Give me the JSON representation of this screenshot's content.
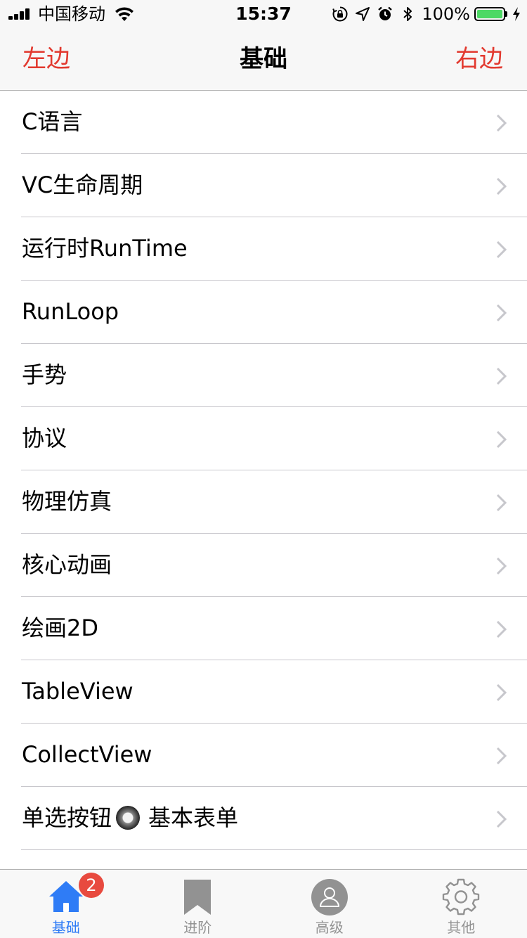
{
  "status_bar": {
    "carrier": "中国移动",
    "time": "15:37",
    "battery_percent": "100%",
    "icons": [
      "signal-icon",
      "wifi-icon",
      "orientation-lock-icon",
      "location-icon",
      "alarm-icon",
      "bluetooth-icon",
      "battery-icon",
      "charging-icon"
    ]
  },
  "nav": {
    "left_label": "左边",
    "title": "基础",
    "right_label": "右边",
    "accent_color": "#e2392f"
  },
  "list": {
    "items": [
      {
        "label": "C语言"
      },
      {
        "label": "VC生命周期"
      },
      {
        "label": "运行时RunTime"
      },
      {
        "label": "RunLoop"
      },
      {
        "label": "手势"
      },
      {
        "label": "协议"
      },
      {
        "label": "物理仿真"
      },
      {
        "label": "核心动画"
      },
      {
        "label": "绘画2D"
      },
      {
        "label": "TableView"
      },
      {
        "label": "CollectView"
      },
      {
        "label_before": "单选按钮",
        "label_after": "基本表单"
      }
    ],
    "chevron_icon": "chevron-right-icon"
  },
  "tab_bar": {
    "active_color": "#2f7cf6",
    "inactive_color": "#929292",
    "tabs": [
      {
        "label": "基础",
        "icon": "home-icon",
        "badge": "2",
        "active": true
      },
      {
        "label": "进阶",
        "icon": "bookmark-icon",
        "active": false
      },
      {
        "label": "高级",
        "icon": "user-icon",
        "active": false
      },
      {
        "label": "其他",
        "icon": "gear-icon",
        "active": false
      }
    ]
  }
}
